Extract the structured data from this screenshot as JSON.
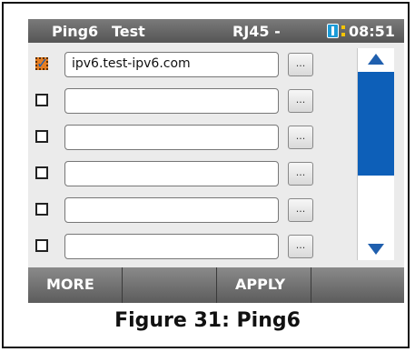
{
  "status_bar": {
    "title": "Ping6",
    "mode": "Test",
    "port": "RJ45 -",
    "time": "08:51",
    "battery_icon": "battery-icon"
  },
  "rows": [
    {
      "checked": true,
      "value": "ipv6.test-ipv6.com",
      "button_label": "..."
    },
    {
      "checked": false,
      "value": "",
      "button_label": "..."
    },
    {
      "checked": false,
      "value": "",
      "button_label": "..."
    },
    {
      "checked": false,
      "value": "",
      "button_label": "..."
    },
    {
      "checked": false,
      "value": "",
      "button_label": "..."
    },
    {
      "checked": false,
      "value": "",
      "button_label": "..."
    }
  ],
  "scrollbar": {
    "up_icon": "arrow-up-icon",
    "down_icon": "arrow-down-icon",
    "accent": "#1f5fae"
  },
  "softkeys": [
    "MORE",
    "",
    "APPLY",
    ""
  ],
  "caption": "Figure 31: Ping6"
}
